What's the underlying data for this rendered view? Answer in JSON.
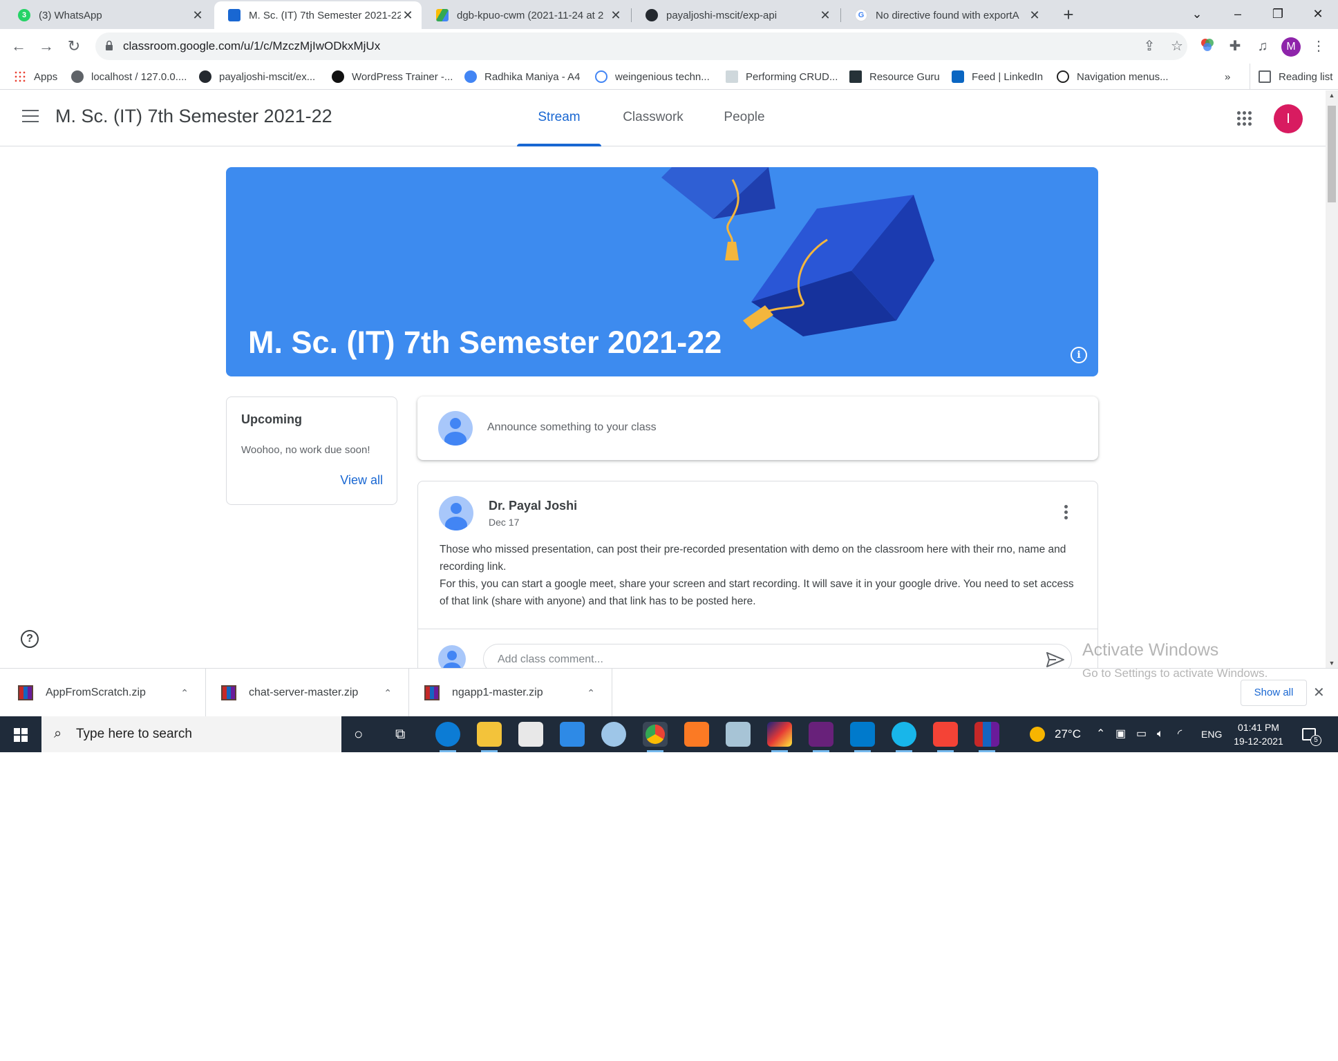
{
  "browser": {
    "tabs": [
      {
        "title": "(3) WhatsApp",
        "active": false
      },
      {
        "title": "M. Sc. (IT) 7th Semester 2021-22",
        "active": true
      },
      {
        "title": "dgb-kpuo-cwm (2021-11-24 at 2",
        "active": false
      },
      {
        "title": "payaljoshi-mscit/exp-api",
        "active": false
      },
      {
        "title": "No directive found with exportA",
        "active": false
      }
    ],
    "whatsapp_badge": "3",
    "new_tab_glyph": "+",
    "url": "classroom.google.com/u/1/c/MzczMjIwODkxMjUx",
    "profile_initial": "M"
  },
  "bookmarks": {
    "items": [
      {
        "label": "Apps"
      },
      {
        "label": "localhost / 127.0.0...."
      },
      {
        "label": "payaljoshi-mscit/ex..."
      },
      {
        "label": "WordPress Trainer -..."
      },
      {
        "label": "Radhika Maniya - A4"
      },
      {
        "label": "weingenious techn..."
      },
      {
        "label": "Performing CRUD..."
      },
      {
        "label": "Resource Guru"
      },
      {
        "label": "Feed | LinkedIn"
      },
      {
        "label": "Navigation menus..."
      }
    ],
    "overflow": "»",
    "reading_list": "Reading list"
  },
  "classroom": {
    "course_name": "M. Sc. (IT) 7th Semester 2021-22",
    "tabs": [
      {
        "label": "Stream",
        "selected": true
      },
      {
        "label": "Classwork",
        "selected": false
      },
      {
        "label": "People",
        "selected": false
      }
    ],
    "account_initial": "I",
    "banner_title": "M. Sc. (IT) 7th Semester 2021-22",
    "upcoming": {
      "heading": "Upcoming",
      "message": "Woohoo, no work due soon!",
      "view_all": "View all"
    },
    "announce_placeholder": "Announce something to your class",
    "post": {
      "author": "Dr. Payal Joshi",
      "date": "Dec 17",
      "body_line1": "Those who missed presentation, can post their pre-recorded presentation with demo on the classroom here with their rno, name and recording link.",
      "body_line2": "For this, you can start a google meet, share your screen and start recording. It will save it in your google drive. You need to set access of that link (share with anyone) and that link has to be posted here.",
      "comment_placeholder": "Add class comment..."
    },
    "help_glyph": "?"
  },
  "watermark": {
    "line1": "Activate Windows",
    "line2": "Go to Settings to activate Windows."
  },
  "downloads": {
    "items": [
      {
        "name": "AppFromScratch.zip"
      },
      {
        "name": "chat-server-master.zip"
      },
      {
        "name": "ngapp1-master.zip"
      }
    ],
    "show_all": "Show all"
  },
  "taskbar": {
    "search_placeholder": "Type here to search",
    "weather": "27°C",
    "language": "ENG",
    "time": "01:41 PM",
    "date": "19-12-2021",
    "notifications": "5"
  },
  "colors": {
    "banner": "#3d8bef",
    "accent": "#1967d2",
    "account_avatar": "#d81b60"
  }
}
